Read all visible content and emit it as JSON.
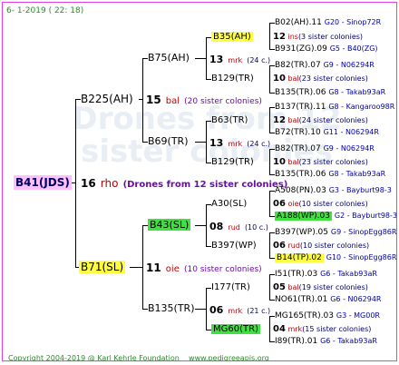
{
  "header": {
    "date": "6-  1-2019 (  22:  18)"
  },
  "footer": {
    "copyright": "Copyright 2004-2019 @ Karl Kehrle Foundation",
    "site": "www.pedigreeapis.org"
  },
  "root": {
    "name": "B41(JDS)",
    "gen_num": "16",
    "code": "rho",
    "note": "(Drones from 12 sister colonies)"
  },
  "gen1": [
    {
      "name": "B225(AH)",
      "num": "15",
      "code": "bal",
      "note": "(20 sister colonies)"
    },
    {
      "name": "B71(SL)",
      "num": "11",
      "code": "oie",
      "note": "(10 sister colonies)"
    }
  ],
  "gen2": [
    {
      "name": "B75(AH)",
      "num": "13",
      "code": "mrk",
      "note": "(24 c.)"
    },
    {
      "name": "B69(TR)",
      "num": "13",
      "code": "mrk",
      "note": "(24 c.)"
    },
    {
      "name": "B43(SL)",
      "num": "08",
      "code": "rud",
      "note": "(10 c.)"
    },
    {
      "name": "B135(TR)",
      "num": "06",
      "code": "mrk",
      "note": "(21 c.)"
    }
  ],
  "gen3": [
    {
      "name": "B35(AH)",
      "num": "12",
      "code": "ins",
      "note": "(3 sister colonies)"
    },
    {
      "name": "B129(TR)",
      "num": "10",
      "code": "bal",
      "note": "(23 sister colonies)"
    },
    {
      "name": "B63(TR)",
      "num": "12",
      "code": "bal",
      "note": "(24 sister colonies)"
    },
    {
      "name": "B129(TR)",
      "num": "10",
      "code": "bal",
      "note": "(23 sister colonies)"
    },
    {
      "name": "A30(SL)",
      "num": "06",
      "code": "oie",
      "note": "(10 sister colonies)"
    },
    {
      "name": "B397(WP)",
      "num": "06",
      "code": "rud",
      "note": "(10 sister colonies)"
    },
    {
      "name": "I177(TR)",
      "num": "05",
      "code": "bal",
      "note": "(19 sister colonies)"
    },
    {
      "name": "MG60(TR)",
      "num": "04",
      "code": "mrk",
      "note": "(15 sister colonies)"
    }
  ],
  "gen4": [
    {
      "name": "B02(AH).11",
      "right": "G20 - Sinop72R"
    },
    {
      "name": "B931(ZG).09",
      "right": "G5 - B40(ZG)"
    },
    {
      "name": "B82(TR).07",
      "right": "G9 - N06294R"
    },
    {
      "name": "B135(TR).06",
      "right": "G8 - Takab93aR"
    },
    {
      "name": "B137(TR).11",
      "right": "G8 - Kangaroo98R"
    },
    {
      "name": "B72(TR).10",
      "right": "G11 - N06294R"
    },
    {
      "name": "B82(TR).07",
      "right": "G9 - N06294R"
    },
    {
      "name": "B135(TR).06",
      "right": "G8 - Takab93aR"
    },
    {
      "name": "A508(PN).03",
      "right": "G3 - Bayburt98-3"
    },
    {
      "name": "A188(WP).03",
      "right": "G2 - Bayburt98-3"
    },
    {
      "name": "B397(WP).05",
      "right": "G9 - SinopEgg86R"
    },
    {
      "name": "B14(TP).02",
      "right": "G10 - SinopEgg86R"
    },
    {
      "name": "I51(TR).03",
      "right": "G6 - Takab93aR"
    },
    {
      "name": "NO61(TR).01",
      "right": "G6 - N06294R"
    },
    {
      "name": "MG165(TR).03",
      "right": "G3 - MG00R"
    },
    {
      "name": "I89(TR).01",
      "right": "G6 - Takab93aR"
    }
  ]
}
